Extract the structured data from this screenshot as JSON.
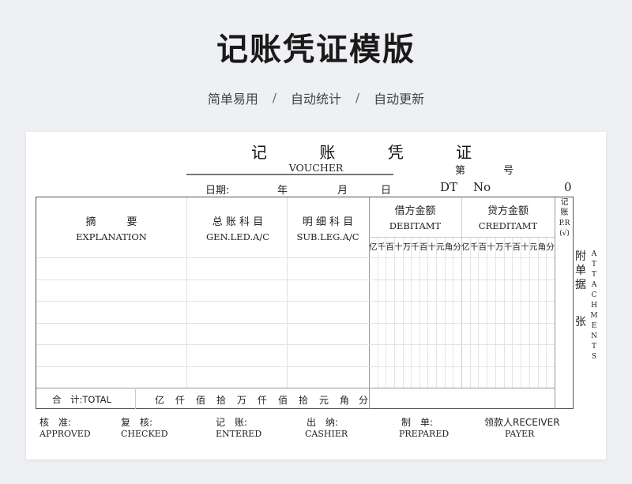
{
  "hero": {
    "title": "记账凭证模版",
    "tags": [
      "简单易用",
      "自动统计",
      "自动更新"
    ],
    "separator": "/"
  },
  "voucher": {
    "title": "记 账 凭 证",
    "subtitle": "VOUCHER",
    "ordinal": "第  号",
    "date_label": "日期:",
    "year": "年",
    "month": "月",
    "day": "日",
    "dt": "DT",
    "no": "No",
    "number": "0",
    "columns": {
      "summary_cn": "摘　　　要",
      "summary_en": "EXPLANATION",
      "ledger_cn": "总 账 科 目",
      "ledger_en": "GEN.LED.A/C",
      "subledger_cn": "明 细 科 目",
      "subledger_en": "SUB.LEG.A/C",
      "debit_cn": "借方金额",
      "debit_en": "DEBITAMT",
      "credit_cn": "贷方金额",
      "credit_en": "CREDITAMT",
      "posted_cn": "记账",
      "posted_en": "P.R",
      "posted_mark": "(√)"
    },
    "digit_units": [
      "亿",
      "千",
      "百",
      "十",
      "万",
      "千",
      "百",
      "十",
      "元",
      "角",
      "分"
    ],
    "total_label": "合　计:TOTAL",
    "total_units": [
      "亿",
      "仟",
      "佰",
      "拾",
      "万",
      "仟",
      "佰",
      "拾",
      "元",
      "角",
      "分"
    ],
    "attachments_cn": [
      "附",
      "单",
      "据"
    ],
    "attachments_unit": "张",
    "attachments_en": "ATTACHMENTS",
    "signatures": [
      {
        "cn": "核　准:",
        "en": "APPROVED"
      },
      {
        "cn": "复　核:",
        "en": "CHECKED"
      },
      {
        "cn": "记　账:",
        "en": "ENTERED"
      },
      {
        "cn": "出　纳:",
        "en": "CASHIER"
      },
      {
        "cn": "制　单:",
        "en": "PREPARED"
      },
      {
        "cn": "领款人RECEIVER",
        "en": "PAYER"
      }
    ]
  }
}
